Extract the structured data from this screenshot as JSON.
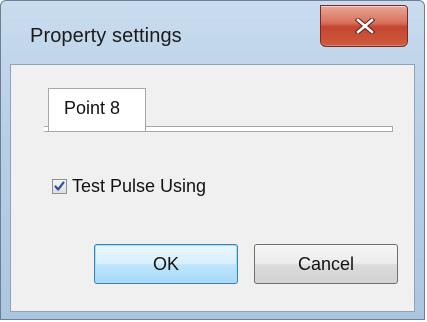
{
  "window": {
    "title": "Property settings",
    "close_icon": "close-x-icon"
  },
  "tabs": [
    {
      "label": "Point 8",
      "selected": true
    }
  ],
  "options": {
    "test_pulse_label": "Test Pulse Using",
    "test_pulse_checked": true
  },
  "buttons": {
    "ok_label": "OK",
    "cancel_label": "Cancel"
  },
  "colors": {
    "close_button": "#c44630",
    "default_button_border": "#3c7fb1",
    "frame": "#b9cfe6"
  }
}
